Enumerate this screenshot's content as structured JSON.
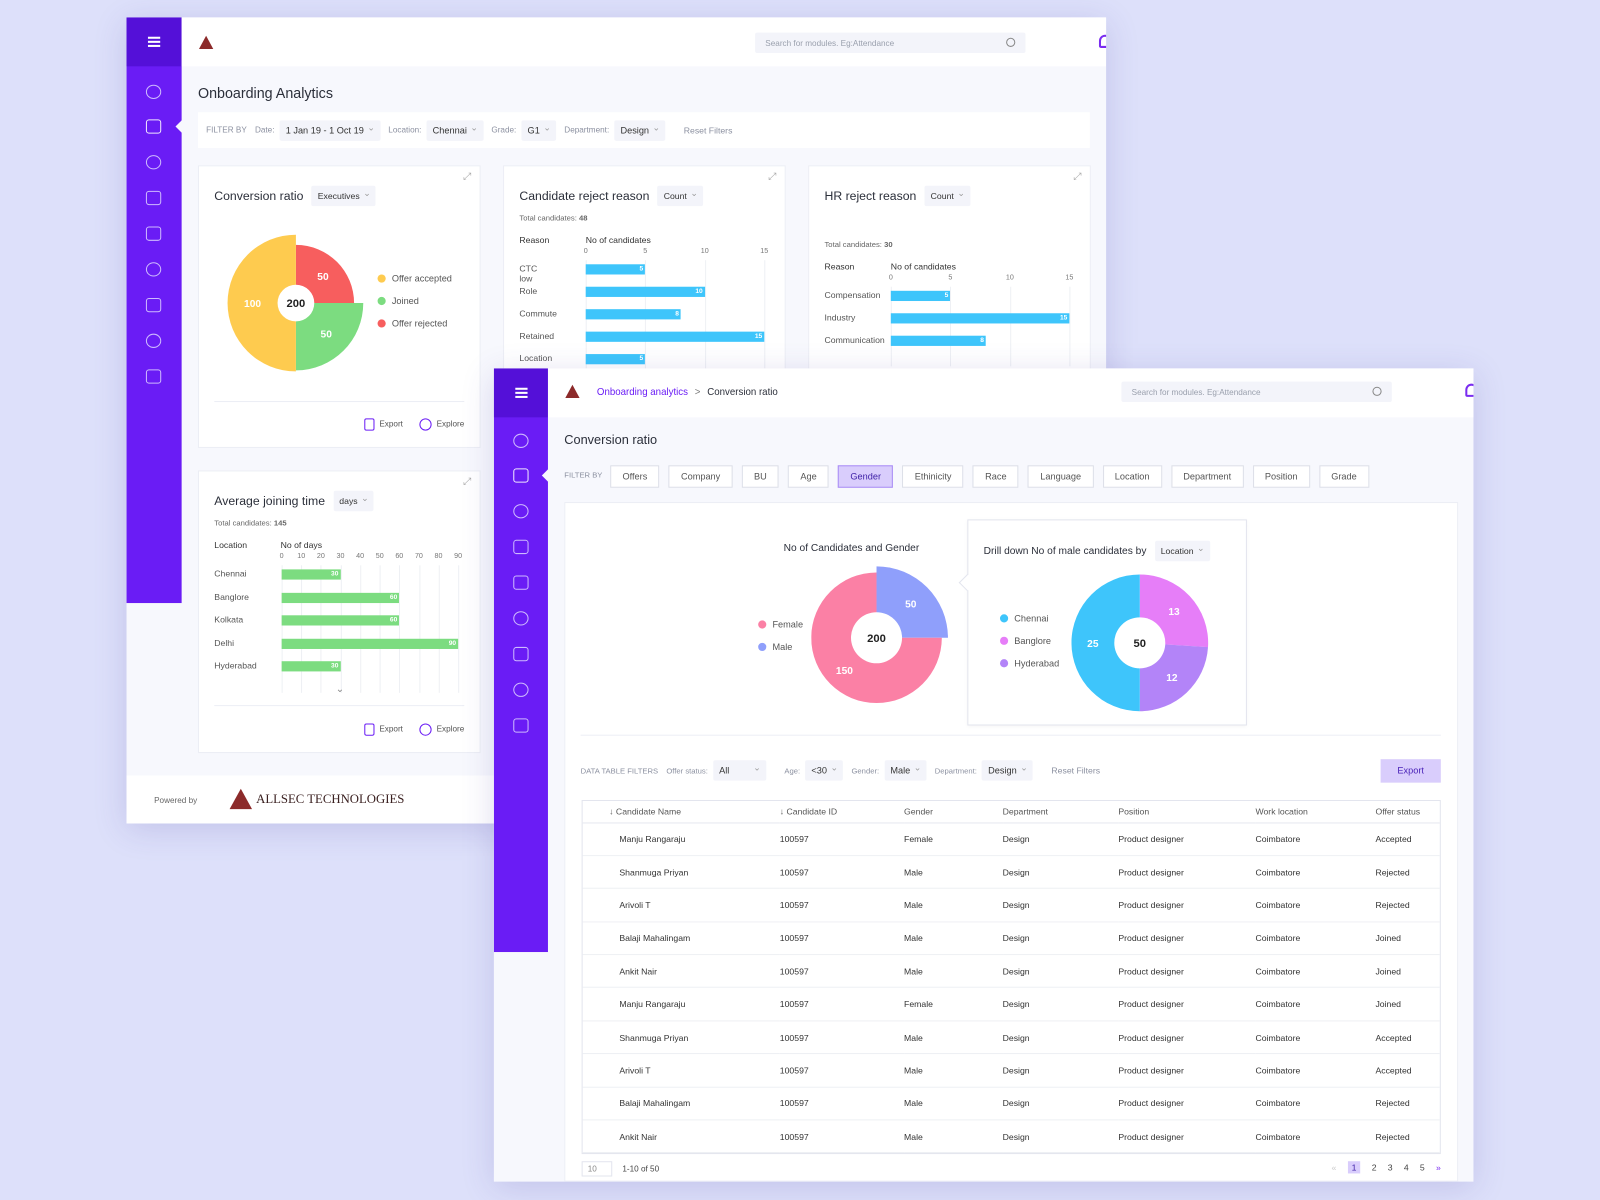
{
  "colors": {
    "sidebar": "#6a1cf5",
    "accent": "#7a2cf0",
    "blue_bar": "#3ec5fb",
    "green_bar": "#7cdc80"
  },
  "window1": {
    "search_placeholder": "Search for modules. Eg:Attendance",
    "title": "Onboarding Analytics",
    "filters": {
      "label": "FILTER BY",
      "date_label": "Date:",
      "date": "1 Jan 19 - 1 Oct 19",
      "location_label": "Location:",
      "location": "Chennai",
      "grade_label": "Grade:",
      "grade": "G1",
      "department_label": "Department:",
      "department": "Design",
      "reset": "Reset Filters"
    },
    "conversion": {
      "title": "Conversion ratio",
      "dropdown": "Executives",
      "center": "200",
      "export": "Export",
      "explore": "Explore",
      "slices": [
        {
          "label": "Offer accepted",
          "value": 100,
          "color": "#fecb4f"
        },
        {
          "label": "Joined",
          "value": 50,
          "color": "#7cdc80"
        },
        {
          "label": "Offer rejected",
          "value": 50,
          "color": "#f75e5e"
        }
      ]
    },
    "reject": {
      "title": "Candidate reject reason",
      "dropdown": "Count",
      "total_label": "Total candidates:",
      "total": "48",
      "col1": "Reason",
      "col2": "No of candidates",
      "ticks": [
        0,
        5,
        10,
        15
      ],
      "max": 15,
      "bars": [
        {
          "label": "CTC low",
          "value": 5
        },
        {
          "label": "Role",
          "value": 10
        },
        {
          "label": "Commute",
          "value": 8
        },
        {
          "label": "Retained",
          "value": 15
        },
        {
          "label": "Location",
          "value": 5
        }
      ]
    },
    "hr": {
      "title": "HR reject reason",
      "dropdown": "Count",
      "total_label": "Total candidates:",
      "total": "30",
      "col1": "Reason",
      "col2": "No of candidates",
      "ticks": [
        0,
        5,
        10,
        15
      ],
      "max": 15,
      "bars": [
        {
          "label": "Compensation",
          "value": 5
        },
        {
          "label": "Industry",
          "value": 15
        },
        {
          "label": "Communication",
          "value": 8
        }
      ]
    },
    "joining": {
      "title": "Average joining time",
      "dropdown": "days",
      "total_label": "Total candidates:",
      "total": "145",
      "col1": "Location",
      "col2": "No of days",
      "ticks": [
        0,
        10,
        20,
        30,
        40,
        50,
        60,
        70,
        80,
        90
      ],
      "max": 90,
      "export": "Export",
      "explore": "Explore",
      "bars": [
        {
          "label": "Chennai",
          "value": 30
        },
        {
          "label": "Banglore",
          "value": 60
        },
        {
          "label": "Kolkata",
          "value": 60
        },
        {
          "label": "Delhi",
          "value": 90
        },
        {
          "label": "Hyderabad",
          "value": 30
        }
      ]
    },
    "footer": {
      "powered": "Powered by",
      "brand": "ALLSEC TECHNOLOGIES"
    }
  },
  "window2": {
    "breadcrumb": {
      "parent": "Onboarding analytics",
      "sep": ">",
      "current": "Conversion ratio"
    },
    "search_placeholder": "Search for modules. Eg:Attendance",
    "title": "Conversion ratio",
    "filter_label": "FILTER BY",
    "tabs": [
      "Offers",
      "Company",
      "BU",
      "Age",
      "Gender",
      "Ethinicity",
      "Race",
      "Language",
      "Location",
      "Department",
      "Position",
      "Grade"
    ],
    "active_tab": "Gender",
    "gender": {
      "title": "No of Candidates and Gender",
      "center": "200",
      "slices": [
        {
          "label": "Female",
          "value": 150,
          "color": "#fb80a5"
        },
        {
          "label": "Male",
          "value": 50,
          "color": "#8f9ffb"
        }
      ]
    },
    "drill": {
      "title": "Drill down No of male candidates by",
      "dropdown": "Location",
      "center": "50",
      "slices": [
        {
          "label": "Chennai",
          "value": 25,
          "color": "#3ec5fb"
        },
        {
          "label": "Banglore",
          "value": 13,
          "color": "#e67ef8"
        },
        {
          "label": "Hyderabad",
          "value": 12,
          "color": "#b384f8"
        }
      ]
    },
    "table_filters": {
      "label": "DATA TABLE FILTERS",
      "offer_label": "Offer status:",
      "offer": "All",
      "age_label": "Age:",
      "age": "<30",
      "gender_label": "Gender:",
      "gender": "Male",
      "dept_label": "Department:",
      "dept": "Design",
      "reset": "Reset Filters",
      "export": "Export"
    },
    "columns": [
      "↓ Candidate Name",
      "↓ Candidate ID",
      "Gender",
      "Department",
      "Position",
      "Work location",
      "Offer status"
    ],
    "rows": [
      [
        "Manju Rangaraju",
        "100597",
        "Female",
        "Design",
        "Product designer",
        "Coimbatore",
        "Accepted"
      ],
      [
        "Shanmuga Priyan",
        "100597",
        "Male",
        "Design",
        "Product designer",
        "Coimbatore",
        "Rejected"
      ],
      [
        "Arivoli T",
        "100597",
        "Male",
        "Design",
        "Product designer",
        "Coimbatore",
        "Rejected"
      ],
      [
        "Balaji Mahalingam",
        "100597",
        "Male",
        "Design",
        "Product designer",
        "Coimbatore",
        "Joined"
      ],
      [
        "Ankit Nair",
        "100597",
        "Male",
        "Design",
        "Product designer",
        "Coimbatore",
        "Joined"
      ],
      [
        "Manju Rangaraju",
        "100597",
        "Female",
        "Design",
        "Product designer",
        "Coimbatore",
        "Joined"
      ],
      [
        "Shanmuga Priyan",
        "100597",
        "Male",
        "Design",
        "Product designer",
        "Coimbatore",
        "Accepted"
      ],
      [
        "Arivoli T",
        "100597",
        "Male",
        "Design",
        "Product designer",
        "Coimbatore",
        "Accepted"
      ],
      [
        "Balaji Mahalingam",
        "100597",
        "Male",
        "Design",
        "Product designer",
        "Coimbatore",
        "Rejected"
      ],
      [
        "Ankit Nair",
        "100597",
        "Male",
        "Design",
        "Product designer",
        "Coimbatore",
        "Rejected"
      ]
    ],
    "pagination": {
      "page_size": "10",
      "range": "1-10 of 50",
      "pages": [
        "1",
        "2",
        "3",
        "4",
        "5"
      ],
      "current": "1"
    }
  }
}
